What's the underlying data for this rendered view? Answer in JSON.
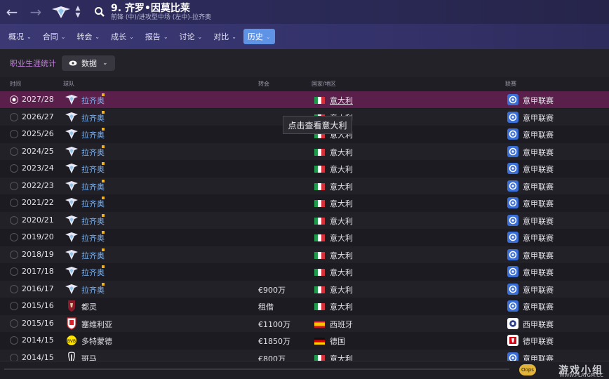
{
  "header": {
    "player_number": "9.",
    "player_name": "齐罗•因莫比莱",
    "player_sub": "前锋 (中)/进攻型中场 (左中)-拉齐奥"
  },
  "tabs": [
    {
      "label": "概况"
    },
    {
      "label": "合同"
    },
    {
      "label": "转会"
    },
    {
      "label": "成长"
    },
    {
      "label": "报告"
    },
    {
      "label": "讨论"
    },
    {
      "label": "对比"
    },
    {
      "label": "历史",
      "active": true
    }
  ],
  "subheader": {
    "section_label": "职业生涯统计",
    "view_label": "数据"
  },
  "columns": {
    "time": "时间",
    "team": "球队",
    "transfer": "转会",
    "country": "国家/地区",
    "league": "联赛"
  },
  "rows": [
    {
      "season": "2027/28",
      "club": "拉齐奥",
      "club_link": true,
      "fee": "",
      "country": "意大利",
      "flag": "it",
      "league": "意甲联赛",
      "crest": "lazio",
      "league_icon": "serie-a",
      "selected": true
    },
    {
      "season": "2026/27",
      "club": "拉齐奥",
      "club_link": true,
      "fee": "",
      "country": "意大利",
      "flag": "it",
      "league": "意甲联赛",
      "crest": "lazio",
      "league_icon": "serie-a"
    },
    {
      "season": "2025/26",
      "club": "拉齐奥",
      "club_link": true,
      "fee": "",
      "country": "意大利",
      "flag": "it",
      "league": "意甲联赛",
      "crest": "lazio",
      "league_icon": "serie-a"
    },
    {
      "season": "2024/25",
      "club": "拉齐奥",
      "club_link": true,
      "fee": "",
      "country": "意大利",
      "flag": "it",
      "league": "意甲联赛",
      "crest": "lazio",
      "league_icon": "serie-a"
    },
    {
      "season": "2023/24",
      "club": "拉齐奥",
      "club_link": true,
      "fee": "",
      "country": "意大利",
      "flag": "it",
      "league": "意甲联赛",
      "crest": "lazio",
      "league_icon": "serie-a"
    },
    {
      "season": "2022/23",
      "club": "拉齐奥",
      "club_link": true,
      "fee": "",
      "country": "意大利",
      "flag": "it",
      "league": "意甲联赛",
      "crest": "lazio",
      "league_icon": "serie-a"
    },
    {
      "season": "2021/22",
      "club": "拉齐奥",
      "club_link": true,
      "fee": "",
      "country": "意大利",
      "flag": "it",
      "league": "意甲联赛",
      "crest": "lazio",
      "league_icon": "serie-a"
    },
    {
      "season": "2020/21",
      "club": "拉齐奥",
      "club_link": true,
      "fee": "",
      "country": "意大利",
      "flag": "it",
      "league": "意甲联赛",
      "crest": "lazio",
      "league_icon": "serie-a"
    },
    {
      "season": "2019/20",
      "club": "拉齐奥",
      "club_link": true,
      "fee": "",
      "country": "意大利",
      "flag": "it",
      "league": "意甲联赛",
      "crest": "lazio",
      "league_icon": "serie-a"
    },
    {
      "season": "2018/19",
      "club": "拉齐奥",
      "club_link": true,
      "fee": "",
      "country": "意大利",
      "flag": "it",
      "league": "意甲联赛",
      "crest": "lazio",
      "league_icon": "serie-a"
    },
    {
      "season": "2017/18",
      "club": "拉齐奥",
      "club_link": true,
      "fee": "",
      "country": "意大利",
      "flag": "it",
      "league": "意甲联赛",
      "crest": "lazio",
      "league_icon": "serie-a"
    },
    {
      "season": "2016/17",
      "club": "拉齐奥",
      "club_link": true,
      "fee": "€900万",
      "country": "意大利",
      "flag": "it",
      "league": "意甲联赛",
      "crest": "lazio",
      "league_icon": "serie-a"
    },
    {
      "season": "2015/16",
      "club": "都灵",
      "club_link": false,
      "fee": "租借",
      "country": "意大利",
      "flag": "it",
      "league": "意甲联赛",
      "crest": "torino",
      "league_icon": "serie-a"
    },
    {
      "season": "2015/16",
      "club": "塞维利亚",
      "club_link": false,
      "fee": "€1100万",
      "country": "西班牙",
      "flag": "es",
      "league": "西甲联赛",
      "crest": "sevilla",
      "league_icon": "la-liga"
    },
    {
      "season": "2014/15",
      "club": "多特蒙德",
      "club_link": false,
      "fee": "€1850万",
      "country": "德国",
      "flag": "de",
      "league": "德甲联赛",
      "crest": "dortmund",
      "league_icon": "bundesliga"
    },
    {
      "season": "2014/15",
      "club": "斑马",
      "club_link": false,
      "fee": "€800万",
      "country": "意大利",
      "flag": "it",
      "league": "意甲联赛",
      "crest": "juventus",
      "league_icon": "serie-a"
    }
  ],
  "tooltip": "点击查看意大利",
  "watermark": {
    "text": "游戏小组",
    "url": "WWW.PLAYGM.CC",
    "badge": "Oops"
  },
  "colors": {
    "accent": "#5f93e6",
    "selected_row": "#5a1f4b",
    "club_link": "#7db3f1",
    "section_label": "#c47fe0"
  }
}
